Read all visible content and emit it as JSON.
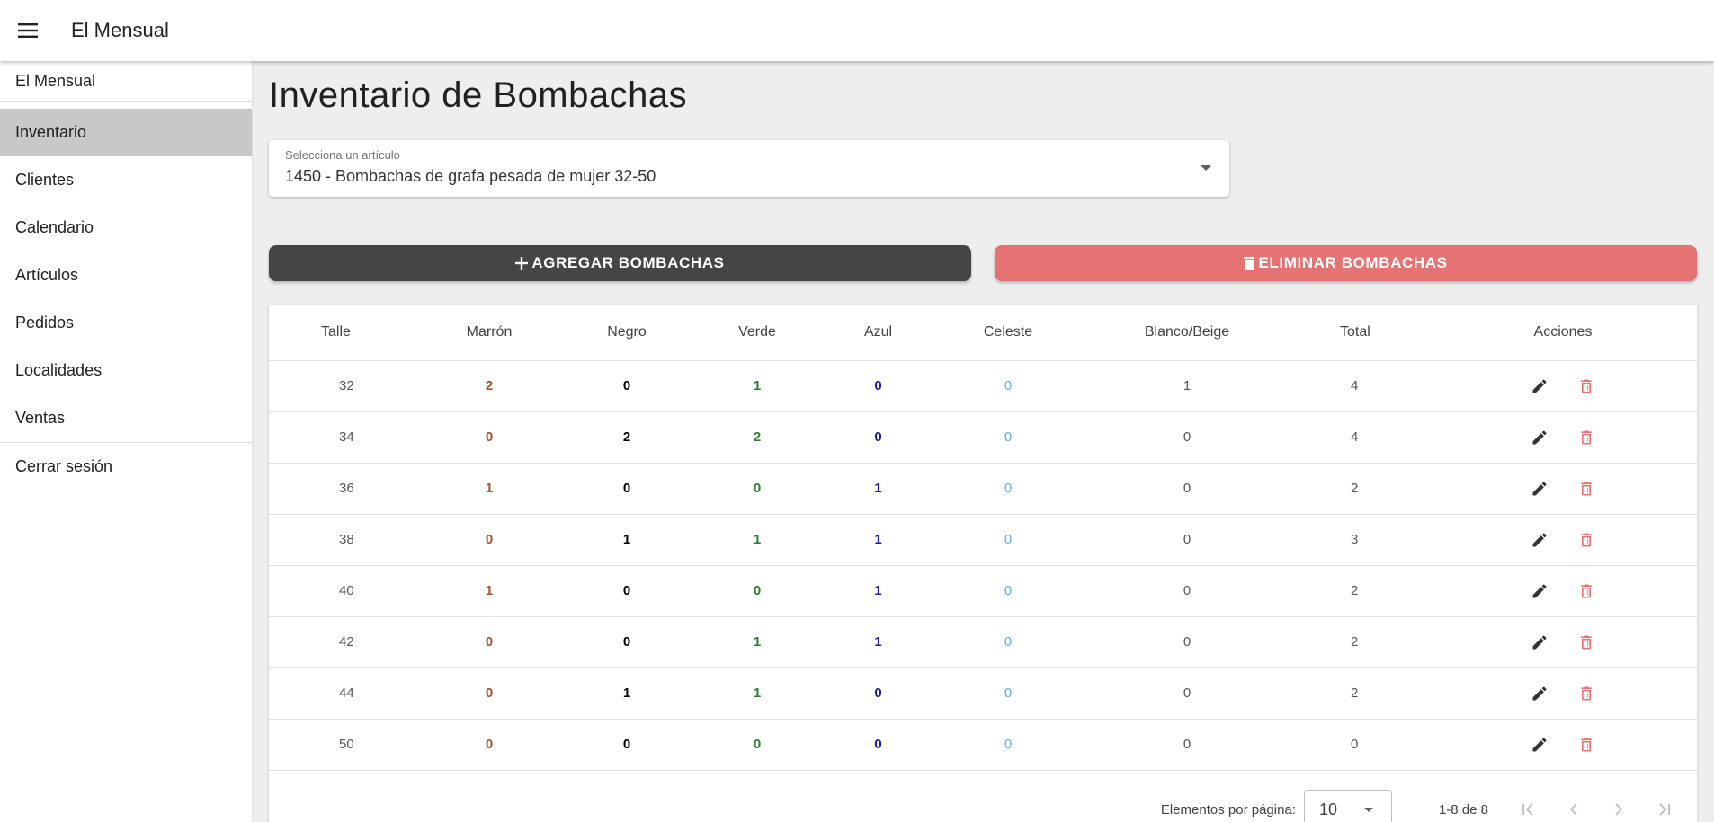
{
  "app": {
    "title": "El Mensual"
  },
  "sidebar": {
    "header": "El Mensual",
    "items": [
      {
        "label": "Inventario",
        "active": true
      },
      {
        "label": "Clientes"
      },
      {
        "label": "Calendario"
      },
      {
        "label": "Artículos"
      },
      {
        "label": "Pedidos"
      },
      {
        "label": "Localidades"
      },
      {
        "label": "Ventas"
      }
    ],
    "logout": "Cerrar sesión"
  },
  "page": {
    "title": "Inventario de Bombachas"
  },
  "select": {
    "label": "Selecciona un artículo",
    "value": "1450 - Bombachas de grafa pesada de mujer 32-50"
  },
  "buttons": {
    "add": "AGREGAR BOMBACHAS",
    "delete": "ELIMINAR BOMBACHAS"
  },
  "colors": {
    "add_button": "#454545",
    "delete_button": "#e57373",
    "marron": "#a0522d",
    "negro": "#000000",
    "verde": "#2e7d32",
    "azul": "#1a1aa6",
    "celeste": "#5dade2"
  },
  "table": {
    "headers": [
      "Talle",
      "Marrón",
      "Negro",
      "Verde",
      "Azul",
      "Celeste",
      "Blanco/Beige",
      "Total",
      "Acciones"
    ],
    "rows": [
      [
        "32",
        "2",
        "0",
        "1",
        "0",
        "0",
        "1",
        "4"
      ],
      [
        "34",
        "0",
        "2",
        "2",
        "0",
        "0",
        "0",
        "4"
      ],
      [
        "36",
        "1",
        "0",
        "0",
        "1",
        "0",
        "0",
        "2"
      ],
      [
        "38",
        "0",
        "1",
        "1",
        "1",
        "0",
        "0",
        "3"
      ],
      [
        "40",
        "1",
        "0",
        "0",
        "1",
        "0",
        "0",
        "2"
      ],
      [
        "42",
        "0",
        "0",
        "1",
        "1",
        "0",
        "0",
        "2"
      ],
      [
        "44",
        "0",
        "1",
        "1",
        "0",
        "0",
        "0",
        "2"
      ],
      [
        "50",
        "0",
        "0",
        "0",
        "0",
        "0",
        "0",
        "0"
      ]
    ],
    "action_icons": [
      "edit-icon",
      "delete-icon"
    ]
  },
  "paginator": {
    "label": "Elementos por página:",
    "page_size": "10",
    "range": "1-8 de 8"
  }
}
